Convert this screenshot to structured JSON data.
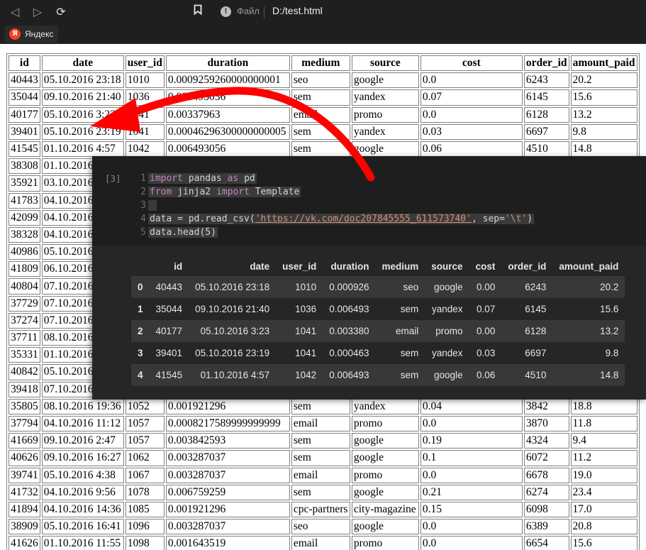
{
  "browser": {
    "site_label": "Файл",
    "address": "D:/test.html",
    "bookmarks": [
      {
        "label": "Яндекс",
        "icon": "yandex-icon"
      }
    ]
  },
  "page_table": {
    "headers": [
      "id",
      "date",
      "user_id",
      "duration",
      "medium",
      "source",
      "cost",
      "order_id",
      "amount_paid"
    ],
    "rows": [
      [
        "40443",
        "05.10.2016 23:18",
        "1010",
        "0.0009259260000000001",
        "seo",
        "google",
        "0.0",
        "6243",
        "20.2"
      ],
      [
        "35044",
        "09.10.2016 21:40",
        "1036",
        "0.006493056",
        "sem",
        "yandex",
        "0.07",
        "6145",
        "15.6"
      ],
      [
        "40177",
        "05.10.2016 3:23",
        "1041",
        "0.00337963",
        "email",
        "promo",
        "0.0",
        "6128",
        "13.2"
      ],
      [
        "39401",
        "05.10.2016 23:19",
        "1041",
        "0.00046296300000000005",
        "sem",
        "yandex",
        "0.03",
        "6697",
        "9.8"
      ],
      [
        "41545",
        "01.10.2016 4:57",
        "1042",
        "0.006493056",
        "sem",
        "google",
        "0.06",
        "4510",
        "14.8"
      ],
      [
        "38308",
        "01.10.2016",
        "",
        "",
        "",
        "",
        "",
        "",
        ""
      ],
      [
        "35921",
        "03.10.2016",
        "",
        "",
        "",
        "",
        "",
        "",
        ""
      ],
      [
        "41783",
        "04.10.2016",
        "",
        "",
        "",
        "",
        "",
        "",
        ""
      ],
      [
        "42099",
        "04.10.2016",
        "",
        "",
        "",
        "",
        "",
        "",
        ""
      ],
      [
        "38328",
        "04.10.2016",
        "",
        "",
        "",
        "",
        "",
        "",
        ""
      ],
      [
        "40986",
        "05.10.2016",
        "",
        "",
        "",
        "",
        "",
        "",
        ""
      ],
      [
        "41809",
        "06.10.2016",
        "",
        "",
        "",
        "",
        "",
        "",
        ""
      ],
      [
        "40804",
        "07.10.2016",
        "",
        "",
        "",
        "",
        "",
        "",
        ""
      ],
      [
        "37729",
        "07.10.2016",
        "",
        "",
        "",
        "",
        "",
        "",
        ""
      ],
      [
        "37274",
        "07.10.2016",
        "",
        "",
        "",
        "",
        "",
        "",
        ""
      ],
      [
        "37711",
        "08.10.2016",
        "",
        "",
        "",
        "",
        "",
        "",
        ""
      ],
      [
        "35331",
        "01.10.2016",
        "",
        "",
        "",
        "",
        "",
        "",
        ""
      ],
      [
        "40842",
        "05.10.2016",
        "",
        "",
        "",
        "",
        "",
        "",
        ""
      ],
      [
        "39418",
        "07.10.2016",
        "",
        "",
        "",
        "",
        "",
        "",
        ""
      ],
      [
        "35805",
        "08.10.2016 19:36",
        "1052",
        "0.001921296",
        "sem",
        "yandex",
        "0.04",
        "3842",
        "18.8"
      ],
      [
        "37794",
        "04.10.2016 11:12",
        "1057",
        "0.0008217589999999999",
        "email",
        "promo",
        "0.0",
        "3870",
        "11.8"
      ],
      [
        "41669",
        "09.10.2016 2:47",
        "1057",
        "0.003842593",
        "sem",
        "google",
        "0.19",
        "4324",
        "9.4"
      ],
      [
        "40626",
        "09.10.2016 16:27",
        "1062",
        "0.003287037",
        "sem",
        "google",
        "0.1",
        "6072",
        "11.2"
      ],
      [
        "39741",
        "05.10.2016 4:38",
        "1067",
        "0.003287037",
        "email",
        "promo",
        "0.0",
        "6678",
        "19.0"
      ],
      [
        "41732",
        "04.10.2016 9:56",
        "1078",
        "0.006759259",
        "sem",
        "google",
        "0.21",
        "6274",
        "23.4"
      ],
      [
        "41894",
        "04.10.2016 14:36",
        "1085",
        "0.001921296",
        "cpc-partners",
        "city-magazine",
        "0.15",
        "6098",
        "17.0"
      ],
      [
        "38909",
        "05.10.2016 16:41",
        "1096",
        "0.003287037",
        "seo",
        "google",
        "0.0",
        "6389",
        "20.8"
      ],
      [
        "41626",
        "01.10.2016 11:55",
        "1098",
        "0.001643519",
        "email",
        "promo",
        "0.0",
        "6654",
        "15.6"
      ]
    ]
  },
  "notebook": {
    "prompt": "[3]",
    "line_numbers": [
      "1",
      "2",
      "3",
      "4",
      "5"
    ],
    "code": {
      "l1_kw1": "import",
      "l1_mid": " pandas ",
      "l1_kw2": "as",
      "l1_end": " pd",
      "l2_kw1": "from",
      "l2_mid": " jinja2 ",
      "l2_kw2": "import",
      "l2_end": " Template",
      "l4_start": "data = pd.read_csv(",
      "l4_url": "'https://vk.com/doc207845555_611573740'",
      "l4_mid": ", sep=",
      "l4_str": "'\\t'",
      "l4_end": ")",
      "l5": "data.head(5)"
    },
    "dataframe": {
      "columns": [
        "",
        "id",
        "date",
        "user_id",
        "duration",
        "medium",
        "source",
        "cost",
        "order_id",
        "amount_paid"
      ],
      "rows": [
        [
          "0",
          "40443",
          "05.10.2016 23:18",
          "1010",
          "0.000926",
          "seo",
          "google",
          "0.00",
          "6243",
          "20.2"
        ],
        [
          "1",
          "35044",
          "09.10.2016 21:40",
          "1036",
          "0.006493",
          "sem",
          "yandex",
          "0.07",
          "6145",
          "15.6"
        ],
        [
          "2",
          "40177",
          "05.10.2016 3:23",
          "1041",
          "0.003380",
          "email",
          "promo",
          "0.00",
          "6128",
          "13.2"
        ],
        [
          "3",
          "39401",
          "05.10.2016 23:19",
          "1041",
          "0.000463",
          "sem",
          "yandex",
          "0.03",
          "6697",
          "9.8"
        ],
        [
          "4",
          "41545",
          "01.10.2016 4:57",
          "1042",
          "0.006493",
          "sem",
          "google",
          "0.06",
          "4510",
          "14.8"
        ]
      ]
    }
  },
  "colors": {
    "browser_chrome": "#1f1f1f",
    "annotation_arrow": "#ff0000",
    "notebook_bg": "#1e1e1e",
    "output_bg": "#262626",
    "keyword": "#c586c0",
    "string": "#ce9178"
  }
}
